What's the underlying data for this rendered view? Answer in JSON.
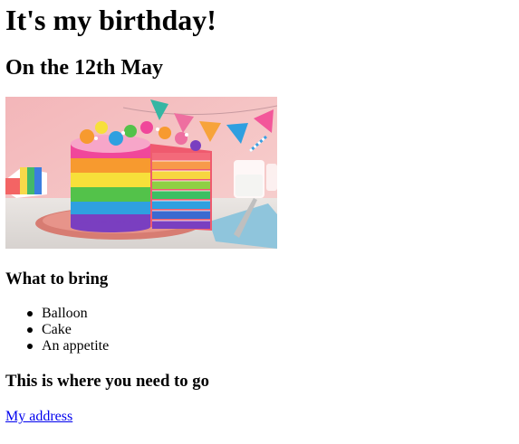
{
  "page": {
    "title": "It's my birthday!",
    "subtitle": "On the 12th May",
    "image": {
      "subject": "rainbow layer cake"
    },
    "bring_heading": "What to bring",
    "bring_items": [
      "Balloon",
      "Cake",
      "An appetite"
    ],
    "where_heading": "This is where you need to go",
    "address_link": "My address"
  },
  "colors": {
    "text": "#000000",
    "link": "#0000ee",
    "background": "#ffffff"
  },
  "icons": {
    "bullet": "disc-bullet-icon"
  }
}
